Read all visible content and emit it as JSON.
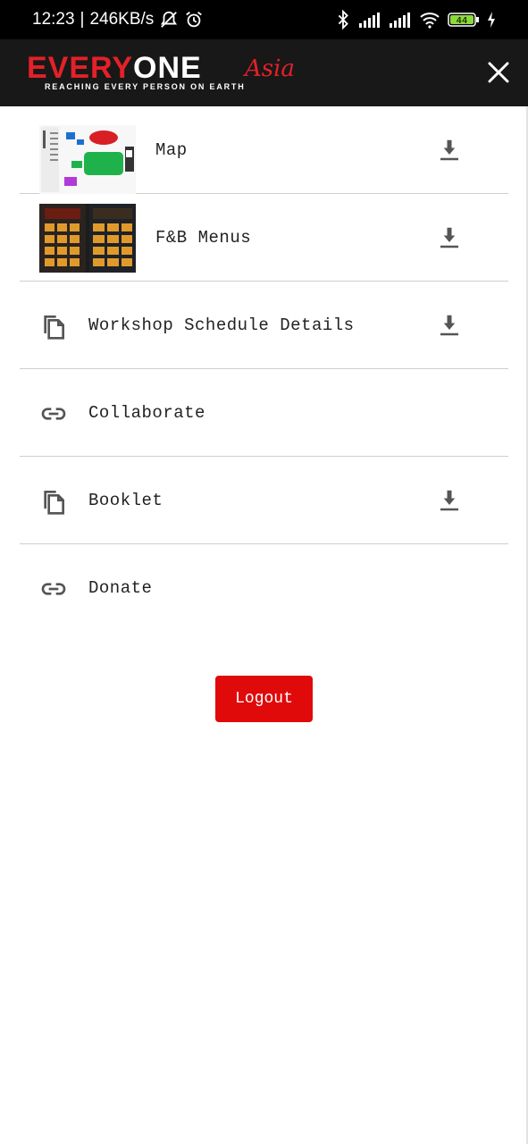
{
  "status_bar": {
    "time": "12:23",
    "net_speed": "246KB/s",
    "battery": "44"
  },
  "header": {
    "logo_part1": "EVERY",
    "logo_part2": "ONE",
    "logo_script": "Asia",
    "tagline": "REACHING EVERY PERSON ON EARTH",
    "close_icon": "close-icon"
  },
  "menu": {
    "items": [
      {
        "label": "Map",
        "lead": "map-thumbnail",
        "trail": "download-icon"
      },
      {
        "label": "F&B Menus",
        "lead": "fb-menus-thumbnail",
        "trail": "download-icon"
      },
      {
        "label": "Workshop Schedule Details",
        "lead": "document-copy-icon",
        "trail": "download-icon"
      },
      {
        "label": "Collaborate",
        "lead": "link-icon",
        "trail": ""
      },
      {
        "label": "Booklet",
        "lead": "document-copy-icon",
        "trail": "download-icon"
      },
      {
        "label": "Donate",
        "lead": "link-icon",
        "trail": ""
      }
    ]
  },
  "logout_label": "Logout",
  "colors": {
    "brand_red": "#e32128",
    "button_red": "#e00a0a",
    "header_bg": "#181818",
    "divider": "#cfcfcf"
  }
}
